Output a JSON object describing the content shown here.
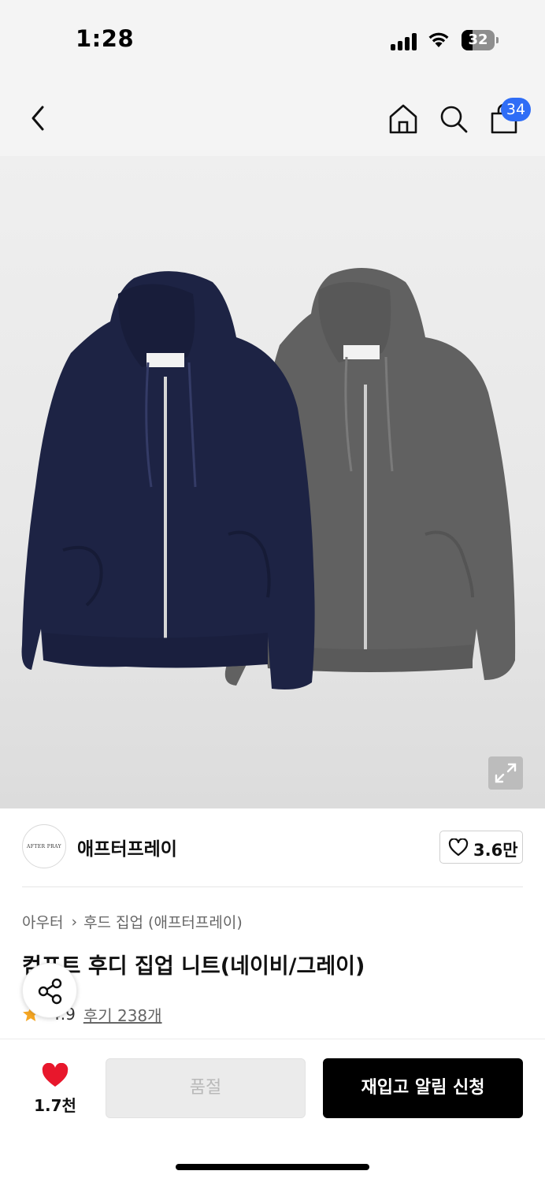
{
  "status_bar": {
    "time": "1:28",
    "battery": "32"
  },
  "nav": {
    "cart_count": "34"
  },
  "brand": {
    "logo_text": "AFTER PRAY",
    "name": "애프터프레이",
    "likes": "3.6만"
  },
  "product": {
    "breadcrumb": [
      "아우터",
      "후드 집업 (애프터프레이)"
    ],
    "title": "컴포트 후디 집업 니트(네이비/그레이)",
    "rating": "4.9",
    "reviews": "후기 238개"
  },
  "bottom_bar": {
    "wish_count": "1.7천",
    "soldout_label": "품절",
    "restock_label": "재입고 알림 신청"
  }
}
